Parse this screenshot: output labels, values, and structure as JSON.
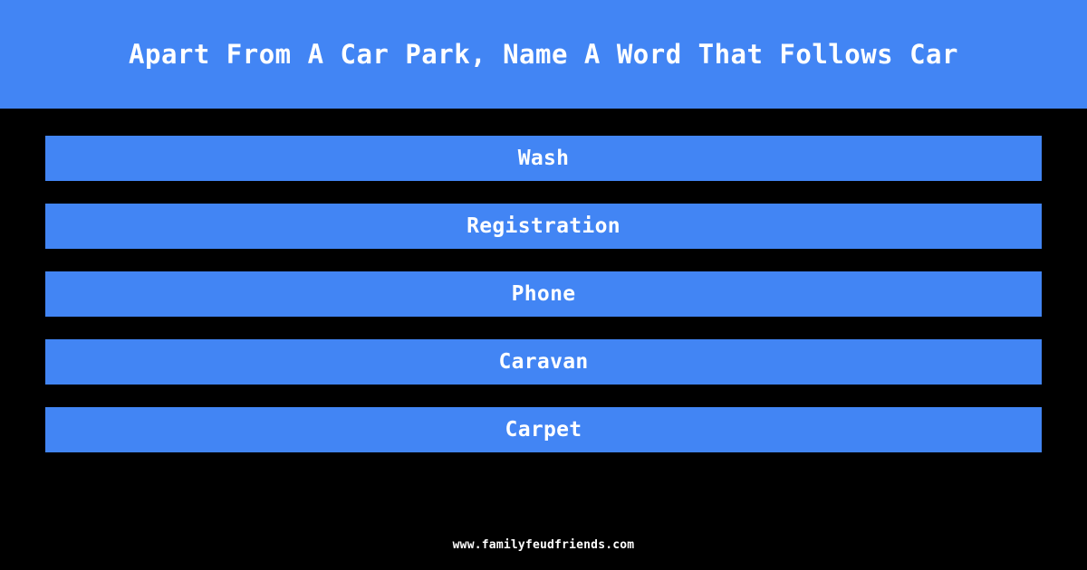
{
  "theme": {
    "background_color": "#000000",
    "accent_color": "#4285f4",
    "text_color": "#ffffff"
  },
  "header": {
    "title": "Apart From A Car Park, Name A Word That Follows Car"
  },
  "answers": {
    "items": [
      {
        "label": "Wash"
      },
      {
        "label": "Registration"
      },
      {
        "label": "Phone"
      },
      {
        "label": "Caravan"
      },
      {
        "label": "Carpet"
      }
    ]
  },
  "footer": {
    "url": "www.familyfeudfriends.com"
  }
}
